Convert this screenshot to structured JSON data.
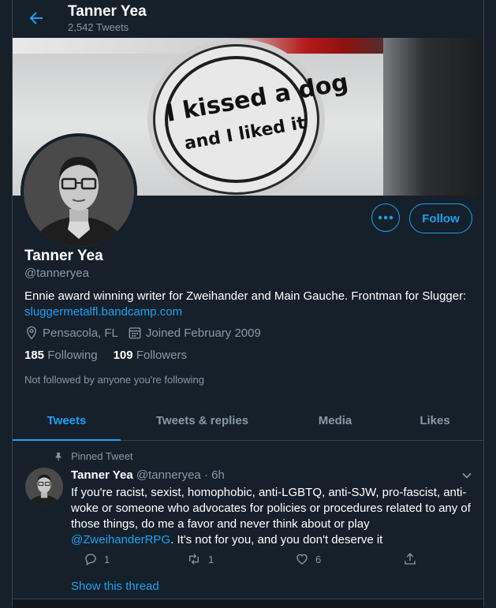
{
  "header": {
    "title": "Tanner Yea",
    "tweet_count": "2,542 Tweets"
  },
  "banner": {
    "sticker_line1": "I kissed a dog",
    "sticker_line2": "and I liked it"
  },
  "profile": {
    "name": "Tanner Yea",
    "handle": "@tanneryea",
    "bio_text": "Ennie award winning writer for Zweihander and Main Gauche. Frontman for Slugger:",
    "bio_link": "sluggermetalfl.bandcamp.com",
    "location": "Pensacola, FL",
    "joined": "Joined February 2009",
    "following_count": "185",
    "following_label": "Following",
    "followers_count": "109",
    "followers_label": "Followers",
    "not_followed": "Not followed by anyone you're following",
    "follow_label": "Follow"
  },
  "tabs": [
    {
      "label": "Tweets",
      "active": true
    },
    {
      "label": "Tweets & replies",
      "active": false
    },
    {
      "label": "Media",
      "active": false
    },
    {
      "label": "Likes",
      "active": false
    }
  ],
  "pinned_tweet": {
    "pin_label": "Pinned Tweet",
    "name": "Tanner Yea",
    "handle_time": "@tanneryea · 6h",
    "text_before": "If you're racist, sexist, homophobic, anti-LGBTQ, anti-SJW, pro-fascist, anti-woke or someone who advocates for policies or procedures related to any of those things, do me a favor and never think about or play ",
    "mention": "@ZweihanderRPG",
    "text_after": ". It's not for you, and you don't deserve it",
    "reply_count": "1",
    "retweet_count": "1",
    "like_count": "6",
    "show_thread": "Show this thread"
  },
  "colors": {
    "background": "#15202b",
    "accent": "#1da1f2",
    "secondary_text": "#8899a6",
    "border": "#38444d"
  }
}
